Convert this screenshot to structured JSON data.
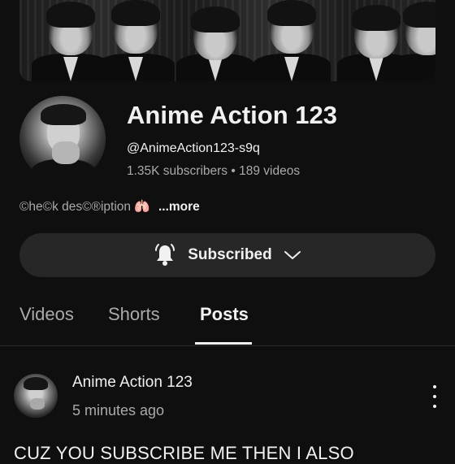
{
  "channel": {
    "name": "Anime Action 123",
    "handle": "@AnimeAction123-s9q",
    "stats": "1.35K subscribers • 189 videos",
    "description": "©he©k des©®iption",
    "description_emoji": "🫁",
    "more_label": "...more"
  },
  "subscribe_button": {
    "label": "Subscribed",
    "icon": "bell-ringing-icon"
  },
  "tabs": [
    {
      "label": "Videos",
      "active": false
    },
    {
      "label": "Shorts",
      "active": false
    },
    {
      "label": "Posts",
      "active": true
    }
  ],
  "post": {
    "author": "Anime Action 123",
    "time": "5 minutes ago",
    "text": "CUZ YOU SUBSCRIBE ME THEN I ALSO"
  },
  "colors": {
    "background": "#0f0f0f",
    "text_primary": "#f1f1f1",
    "text_secondary": "#aaaaaa",
    "button_bg": "#272727"
  }
}
